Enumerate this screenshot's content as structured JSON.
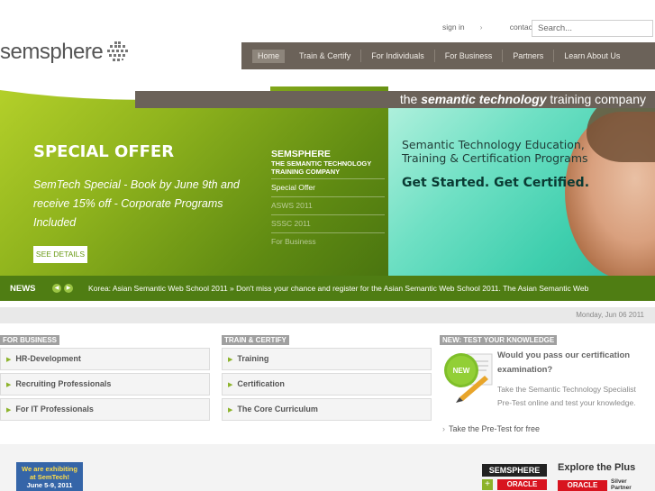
{
  "header": {
    "links": [
      {
        "label": "sign in"
      },
      {
        "label": "contact us"
      }
    ],
    "link_arrow": "›",
    "search_placeholder": "Search...",
    "logo_text": "semsphere"
  },
  "nav": {
    "items": [
      {
        "label": "Home",
        "active": true
      },
      {
        "label": "Train & Certify"
      },
      {
        "label": "For Individuals"
      },
      {
        "label": "For Business"
      },
      {
        "label": "Partners"
      },
      {
        "label": "Learn About Us"
      }
    ]
  },
  "tagline": {
    "prefix": "the ",
    "emphasis": "semantic technology",
    "suffix": " training company"
  },
  "hero": {
    "offer_title": "SPECIAL OFFER",
    "offer_text": "SemTech Special - Book by June 9th and receive 15% off - Corporate Programs Included",
    "see_details": "SEE DETAILS",
    "side_title": "SEMSPHERE",
    "side_subtitle": "THE SEMANTIC TECHNOLOGY TRAINING COMPANY",
    "side_items": [
      {
        "label": "Special Offer"
      },
      {
        "label": "ASWS 2011"
      },
      {
        "label": "SSSC 2011"
      },
      {
        "label": "For Business"
      }
    ],
    "right_title_line1": "Semantic Technology Education,",
    "right_title_line2": "Training & Certification Programs",
    "right_cta": "Get Started. Get Certified."
  },
  "news": {
    "label": "NEWS",
    "prev": "◀",
    "next": "▶",
    "text": "Korea: Asian Semantic Web School 2011 » Don't miss your chance and register for the Asian Semantic Web School 2011. The Asian Semantic Web"
  },
  "date": "Monday, Jun 06 2011",
  "columns": {
    "business": {
      "heading": "FOR BUSINESS",
      "items": [
        {
          "label": "HR-Development"
        },
        {
          "label": "Recruiting Professionals"
        },
        {
          "label": "For IT Professionals"
        }
      ]
    },
    "train": {
      "heading": "TRAIN & CERTIFY",
      "items": [
        {
          "label": "Training"
        },
        {
          "label": "Certification"
        },
        {
          "label": "The Core Curriculum"
        }
      ]
    },
    "quiz": {
      "heading": "NEW: TEST YOUR KNOWLEDGE",
      "badge": "NEW",
      "title": "Would you pass our certification examination?",
      "text": "Take the Semantic Technology Specialist Pre-Test online and test your knowledge.",
      "link": "Take the Pre-Test for free"
    }
  },
  "footer": {
    "semtech_line1": "We are exhibiting",
    "semtech_line2": "at SemTech!",
    "semtech_line3": "June 5-9, 2011",
    "semsphere_logo": "SEMSPHERE",
    "oracle_logo": "ORACLE",
    "plus": "+",
    "explore": "Explore the Plus",
    "oracle_logo2": "ORACLE",
    "silver_line1": "Silver",
    "silver_line2": "Partner"
  },
  "colors": {
    "nav_bg": "#6b6259",
    "green": "#4f7d13",
    "accent": "#8cb32a"
  }
}
